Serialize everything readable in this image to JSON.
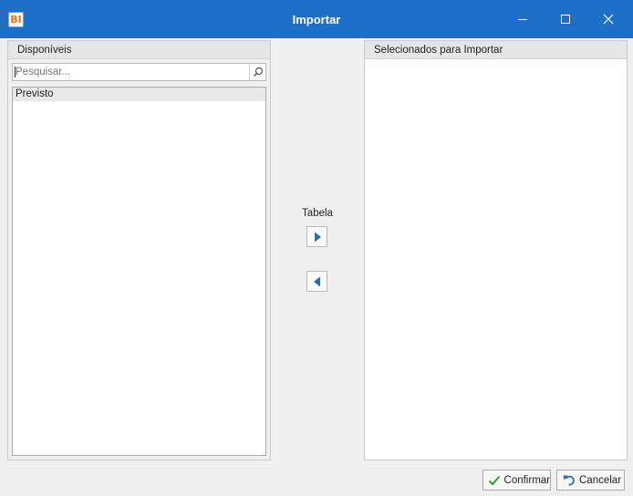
{
  "window": {
    "title": "Importar",
    "logo_text": "BI"
  },
  "available_panel": {
    "header": "Disponíveis",
    "search_placeholder": "Pesquisar...",
    "list_header": "Previsto"
  },
  "transfer": {
    "label": "Tabela"
  },
  "selected_panel": {
    "header": "Selecionados para Importar"
  },
  "footer": {
    "confirm_label": "Confirmar",
    "cancel_label": "Cancelar"
  },
  "colors": {
    "titlebar": "#1e6fc8",
    "logo_accent": "#e5741a",
    "arrow": "#2a6db5",
    "confirm_icon": "#3a9a3a",
    "cancel_icon": "#2a6db5"
  },
  "icons": {
    "logo": "bi-logo-icon",
    "minimize": "minimize-icon",
    "maximize": "maximize-icon",
    "close": "close-icon",
    "search": "search-icon",
    "move_right": "arrow-right-icon",
    "move_left": "arrow-left-icon",
    "confirm": "check-icon",
    "cancel": "undo-icon"
  }
}
